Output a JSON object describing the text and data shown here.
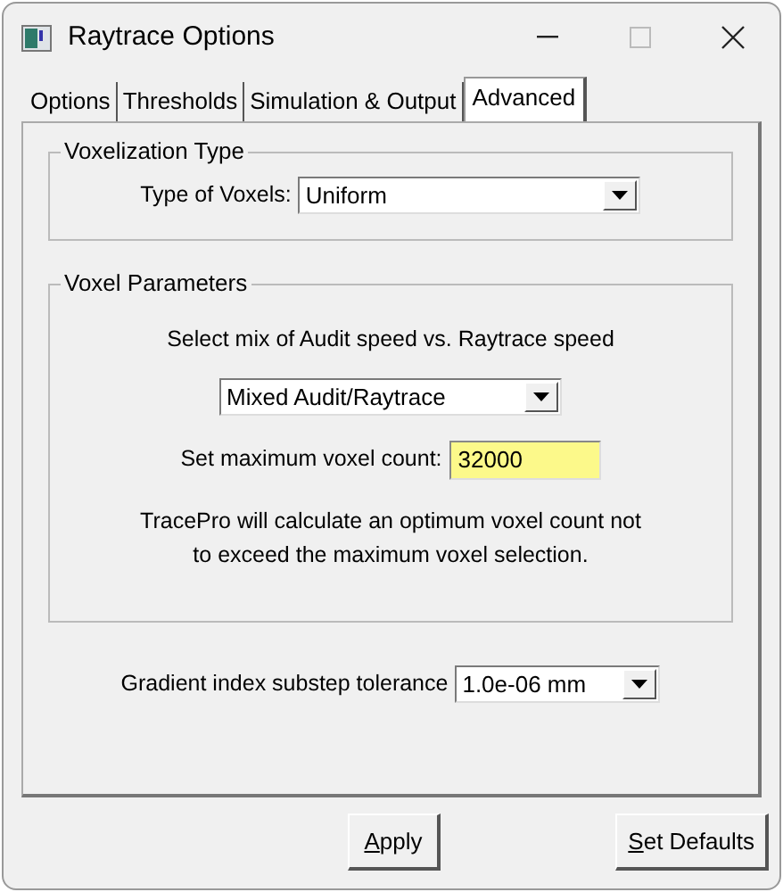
{
  "window": {
    "title": "Raytrace Options"
  },
  "tabs": [
    {
      "label": "Options",
      "selected": false
    },
    {
      "label": "Thresholds",
      "selected": false
    },
    {
      "label": "Simulation & Output",
      "selected": false
    },
    {
      "label": "Advanced",
      "selected": true
    }
  ],
  "groups": [
    {
      "title": "Voxelization Type",
      "rows": [
        {
          "kind": "labeled-select",
          "label": "Type of Voxels:",
          "value": "Uniform"
        }
      ]
    },
    {
      "title": "Voxel Parameters",
      "rows": [
        {
          "kind": "text",
          "text": "Select mix of Audit speed vs. Raytrace speed"
        },
        {
          "kind": "select",
          "value": "Mixed Audit/Raytrace"
        },
        {
          "kind": "labeled-input",
          "label": "Set maximum voxel count:",
          "value": "32000"
        },
        {
          "kind": "text",
          "text": "TracePro will calculate an optimum voxel count not to exceed the maximum voxel selection."
        }
      ]
    }
  ],
  "gradient": {
    "label": "Gradient index substep tolerance",
    "value": "1.0e-06 mm"
  },
  "buttons": [
    {
      "label": "Apply",
      "underline_first": true
    },
    {
      "label": "Set Defaults",
      "underline_first": true
    }
  ]
}
